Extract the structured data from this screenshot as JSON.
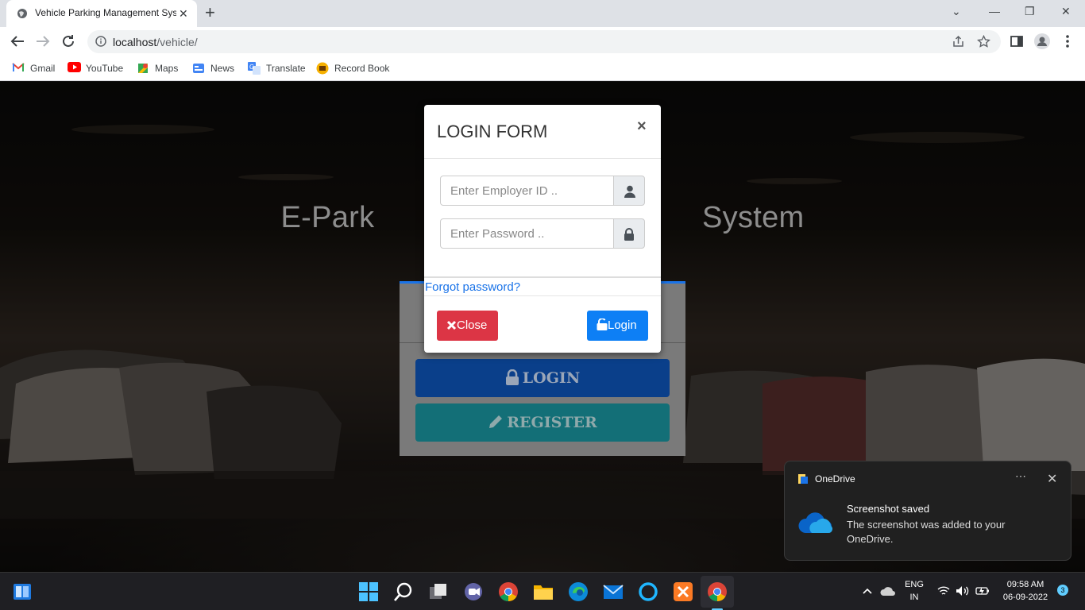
{
  "browser": {
    "tab_title": "Vehicle Parking Management Sys",
    "url_host": "localhost",
    "url_path": "/vehicle/",
    "bookmarks": [
      "Gmail",
      "YouTube",
      "Maps",
      "News",
      "Translate",
      "Record Book"
    ]
  },
  "page": {
    "hero_title": "E-Park                                      System",
    "login_button": "LOGIN",
    "register_button": "REGISTER"
  },
  "modal": {
    "title": "LOGIN FORM",
    "close_x": "×",
    "employer_placeholder": "Enter Employer ID ..",
    "password_placeholder": "Enter Password ..",
    "forgot_link": "Forgot password?",
    "close_button": "Close",
    "login_button": "Login"
  },
  "toast": {
    "app": "OneDrive",
    "heading": "Screenshot saved",
    "body": "The screenshot was added to your OneDrive."
  },
  "taskbar": {
    "lang_top": "ENG",
    "lang_bottom": "IN",
    "time": "09:58 AM",
    "date": "06-09-2022",
    "notification_count": "3"
  },
  "colors": {
    "accent_blue": "#0d7ff5",
    "danger_red": "#dc3545",
    "link_blue": "#1a73e8"
  }
}
